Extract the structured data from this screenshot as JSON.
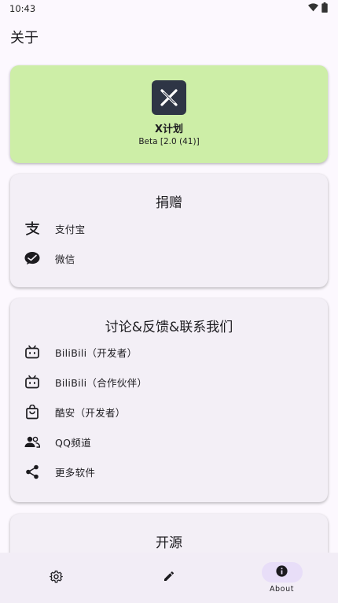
{
  "status_bar": {
    "time": "10:43"
  },
  "page": {
    "title": "关于"
  },
  "app_card": {
    "name": "X计划",
    "version": "Beta [2.0 (41)]",
    "bg_color": "#cdeea7"
  },
  "donate_card": {
    "heading": "捐赠",
    "items": [
      {
        "icon": "alipay-icon",
        "label": "支付宝"
      },
      {
        "icon": "wechat-icon",
        "label": "微信"
      }
    ]
  },
  "contact_card": {
    "heading": "讨论&反馈&联系我们",
    "items": [
      {
        "icon": "bilibili-icon",
        "label": "BiliBili（开发者）"
      },
      {
        "icon": "bilibili-icon",
        "label": "BiliBili（合作伙伴）"
      },
      {
        "icon": "shopping-bag-icon",
        "label": "酷安（开发者）"
      },
      {
        "icon": "group-icon",
        "label": "QQ频道"
      },
      {
        "icon": "share-icon",
        "label": "更多软件"
      }
    ]
  },
  "open_source_card": {
    "heading": "开源"
  },
  "bottom_nav": {
    "items": [
      {
        "icon": "gear-icon",
        "label": ""
      },
      {
        "icon": "pencil-icon",
        "label": ""
      },
      {
        "icon": "info-icon",
        "label": "About",
        "active": true
      }
    ]
  }
}
